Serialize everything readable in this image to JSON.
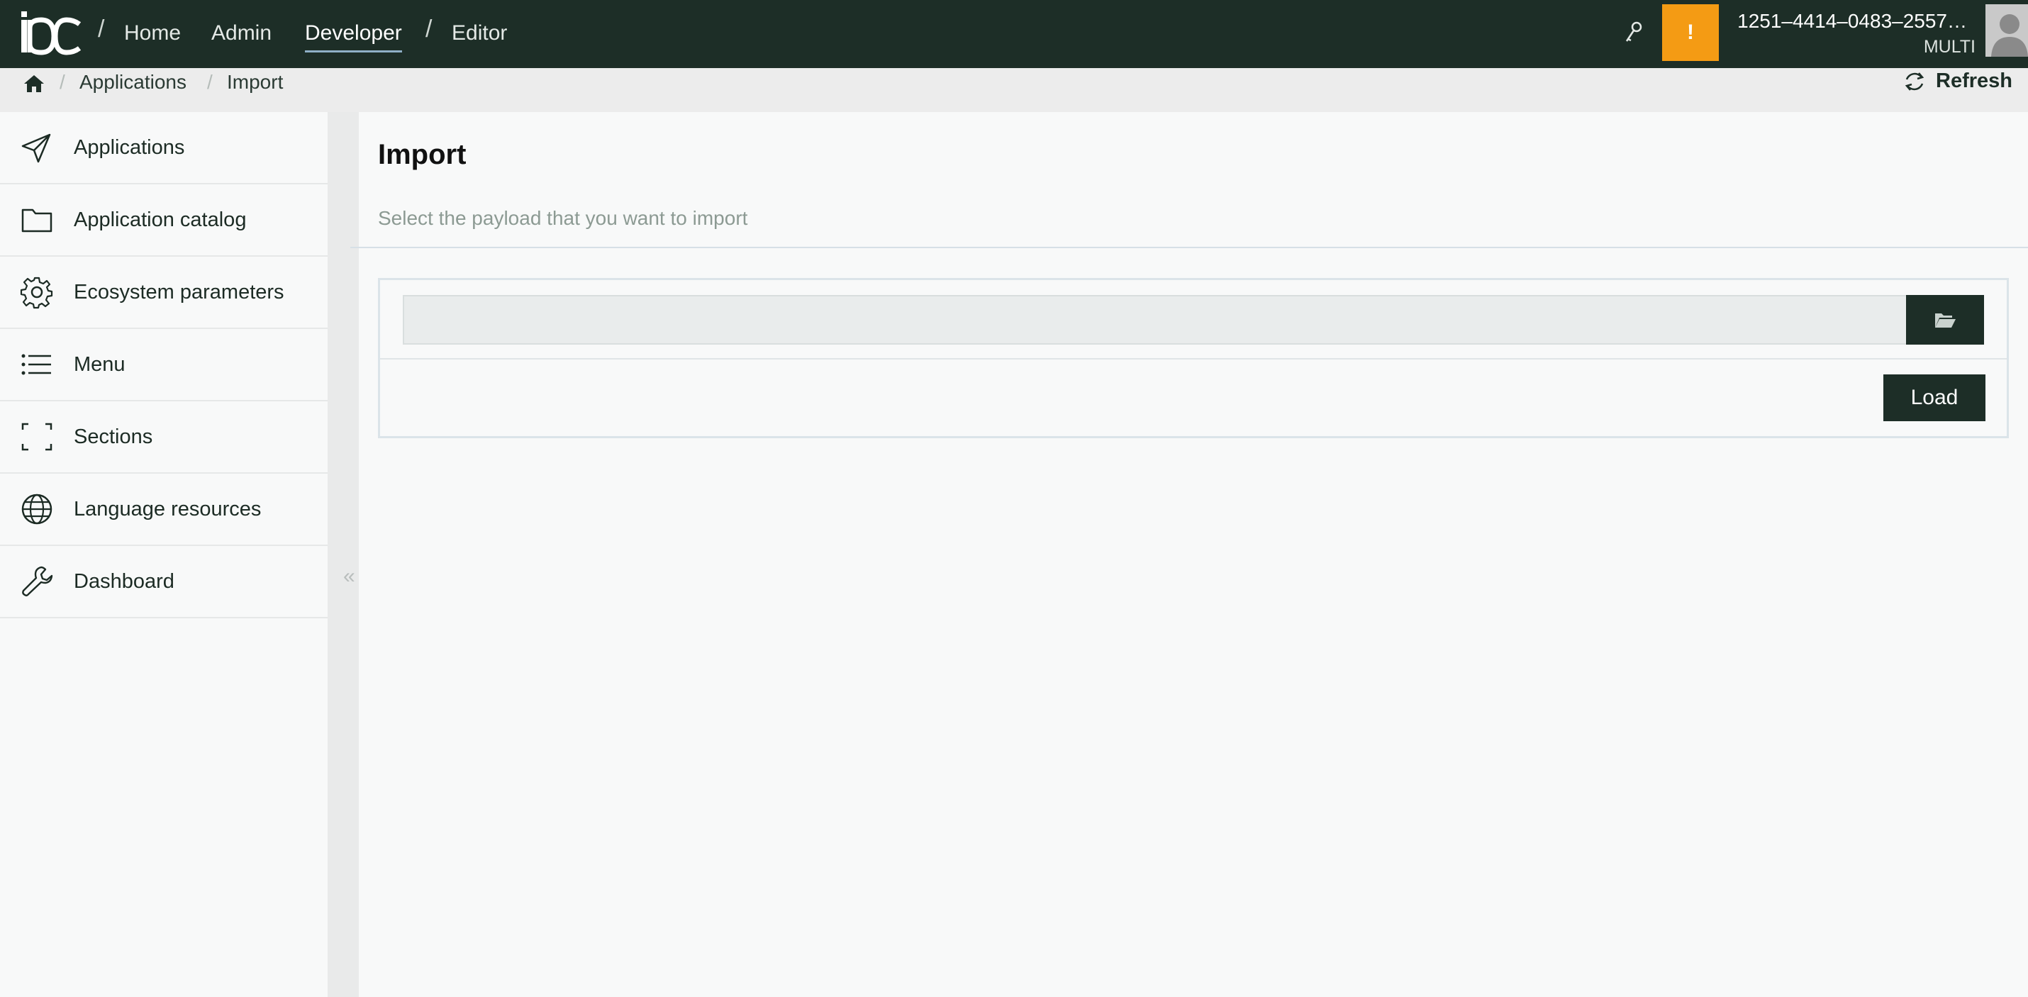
{
  "header": {
    "logo_text": "ibc",
    "nav": [
      {
        "label": "Home"
      },
      {
        "label": "Admin"
      },
      {
        "label": "Developer"
      },
      {
        "label": "Editor"
      }
    ],
    "alert_symbol": "!",
    "account_id": "1251–4414–0483–2557…",
    "account_role": "MULTI"
  },
  "breadcrumb": {
    "items": [
      {
        "label": "Applications"
      },
      {
        "label": "Import"
      }
    ],
    "refresh_label": "Refresh"
  },
  "sidebar": {
    "items": [
      {
        "label": "Applications",
        "icon": "paper-plane-icon"
      },
      {
        "label": "Application catalog",
        "icon": "folder-icon"
      },
      {
        "label": "Ecosystem parameters",
        "icon": "gear-icon"
      },
      {
        "label": "Menu",
        "icon": "list-icon"
      },
      {
        "label": "Sections",
        "icon": "frame-corners-icon"
      },
      {
        "label": "Language resources",
        "icon": "globe-icon"
      },
      {
        "label": "Dashboard",
        "icon": "wrench-icon"
      }
    ],
    "collapse_symbol": "«"
  },
  "main": {
    "title": "Import",
    "subtitle": "Select the payload that you want to import",
    "file_input_value": "",
    "load_label": "Load"
  },
  "colors": {
    "topbar": "#1d2e27",
    "alert": "#f49b14",
    "primary_button": "#1d2e27"
  }
}
